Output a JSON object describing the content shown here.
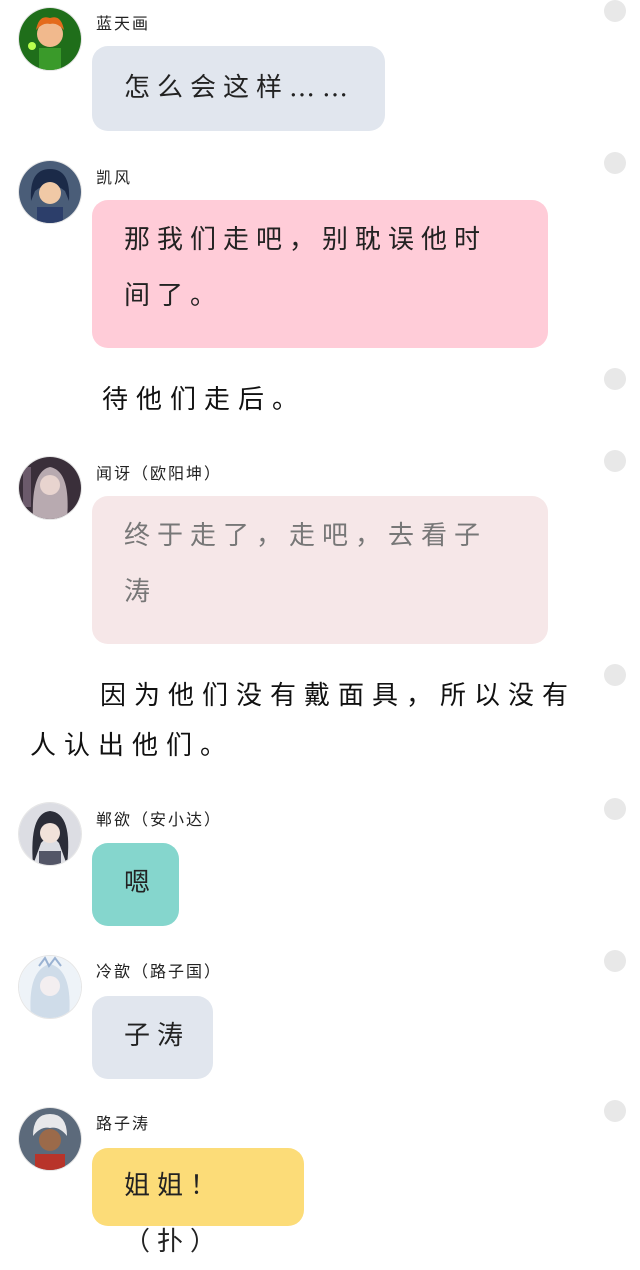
{
  "messages": [
    {
      "name": "蓝天画",
      "text": "怎么会这样……",
      "bubble_color": "#e1e6ee"
    },
    {
      "name": "凯风",
      "text_line1": "那我们走吧，别耽误他时",
      "text_line2": "间了。",
      "bubble_color": "#ffccd8"
    },
    {
      "name": "闻讶（欧阳坤）",
      "text_line1": "终于走了，走吧，去看子",
      "text_line2": "涛",
      "bubble_color": "#f6e7e8",
      "text_color": "#777777"
    },
    {
      "name": "郸欲（安小达）",
      "text": "嗯",
      "bubble_color": "#85d6cd"
    },
    {
      "name": "冷歆（路子国）",
      "text": "子涛",
      "bubble_color": "#e1e6ee"
    },
    {
      "name": "路子涛",
      "text": "姐姐！（扑）",
      "bubble_color": "#fcdc78"
    }
  ],
  "narrations": {
    "after_leave": "待他们走后。",
    "masks_line1": "因为他们没有戴面具，所以没有",
    "masks_line2": "人认出他们。"
  },
  "icons": {
    "status_dot": "status-dot-icon"
  }
}
